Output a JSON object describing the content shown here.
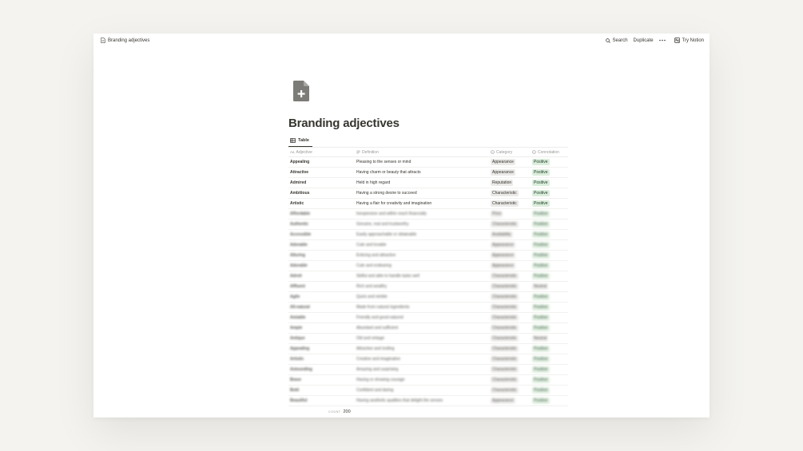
{
  "topbar": {
    "page_name": "Branding adjectives",
    "search_label": "Search",
    "duplicate_label": "Duplicate",
    "more_icon": "more-horizontal-icon",
    "try_label": "Try Notion"
  },
  "page": {
    "icon": "document-plus-icon",
    "title": "Branding adjectives"
  },
  "view": {
    "tab_label": "Table"
  },
  "table": {
    "columns": [
      {
        "label": "Adjective",
        "icon": "title-aa-icon"
      },
      {
        "label": "Definition",
        "icon": "text-lines-icon"
      },
      {
        "label": "Category",
        "icon": "select-circle-icon"
      },
      {
        "label": "Connotation",
        "icon": "select-circle-icon"
      }
    ],
    "rows": [
      {
        "adjective": "Appealing",
        "definition": "Pleasing to the senses or mind",
        "category": "Appearance",
        "connotation": "Positive"
      },
      {
        "adjective": "Attractive",
        "definition": "Having charm or beauty that attracts",
        "category": "Appearance",
        "connotation": "Positive"
      },
      {
        "adjective": "Admired",
        "definition": "Held in high regard",
        "category": "Reputation",
        "connotation": "Positive"
      },
      {
        "adjective": "Ambitious",
        "definition": "Having a strong desire to succeed",
        "category": "Characteristic",
        "connotation": "Positive"
      },
      {
        "adjective": "Artistic",
        "definition": "Having a flair for creativity and imagination",
        "category": "Characteristic",
        "connotation": "Positive"
      },
      {
        "adjective": "Affordable",
        "definition": "Inexpensive and within reach financially",
        "category": "Price",
        "connotation": "Positive"
      },
      {
        "adjective": "Authentic",
        "definition": "Genuine, real and trustworthy",
        "category": "Characteristic",
        "connotation": "Positive"
      },
      {
        "adjective": "Accessible",
        "definition": "Easily approachable or obtainable",
        "category": "Availability",
        "connotation": "Positive"
      },
      {
        "adjective": "Adorable",
        "definition": "Cute and lovable",
        "category": "Appearance",
        "connotation": "Positive"
      },
      {
        "adjective": "Alluring",
        "definition": "Enticing and attractive",
        "category": "Appearance",
        "connotation": "Positive"
      },
      {
        "adjective": "Adorable",
        "definition": "Cute and endearing",
        "category": "Appearance",
        "connotation": "Positive"
      },
      {
        "adjective": "Adroit",
        "definition": "Skilful and able to handle tasks well",
        "category": "Characteristic",
        "connotation": "Positive"
      },
      {
        "adjective": "Affluent",
        "definition": "Rich and wealthy",
        "category": "Characteristic",
        "connotation": "Neutral"
      },
      {
        "adjective": "Agile",
        "definition": "Quick and nimble",
        "category": "Characteristic",
        "connotation": "Positive"
      },
      {
        "adjective": "All-natural",
        "definition": "Made from natural ingredients",
        "category": "Characteristic",
        "connotation": "Positive"
      },
      {
        "adjective": "Amiable",
        "definition": "Friendly and good-natured",
        "category": "Characteristic",
        "connotation": "Positive"
      },
      {
        "adjective": "Ample",
        "definition": "Abundant and sufficient",
        "category": "Characteristic",
        "connotation": "Positive"
      },
      {
        "adjective": "Antique",
        "definition": "Old and vintage",
        "category": "Characteristic",
        "connotation": "Neutral"
      },
      {
        "adjective": "Appealing",
        "definition": "Attractive and inviting",
        "category": "Characteristic",
        "connotation": "Positive"
      },
      {
        "adjective": "Artistic",
        "definition": "Creative and imaginative",
        "category": "Characteristic",
        "connotation": "Positive"
      },
      {
        "adjective": "Astounding",
        "definition": "Amazing and surprising",
        "category": "Characteristic",
        "connotation": "Positive"
      },
      {
        "adjective": "Brave",
        "definition": "Having or showing courage",
        "category": "Characteristic",
        "connotation": "Positive"
      },
      {
        "adjective": "Bold",
        "definition": "Confident and daring",
        "category": "Characteristic",
        "connotation": "Positive"
      },
      {
        "adjective": "Beautiful",
        "definition": "Having aesthetic qualities that delight the senses",
        "category": "Appearance",
        "connotation": "Positive"
      }
    ],
    "clear_rows": 5
  },
  "footer": {
    "count_label": "COUNT",
    "count_value": "200"
  },
  "colors": {
    "background": "#f4f3ef",
    "text": "#37352f",
    "muted": "#9b9a97",
    "tag_gray": "#ebeae8",
    "tag_green": "#dbeddb"
  }
}
